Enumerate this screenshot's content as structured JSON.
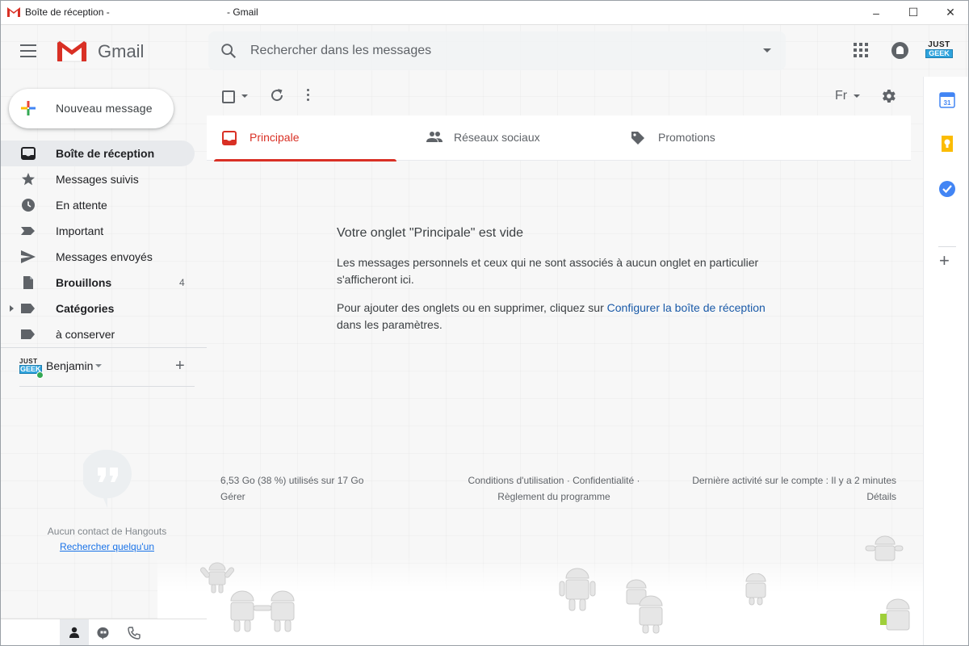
{
  "window": {
    "title_left": "Boîte de réception -",
    "title_right": "- Gmail",
    "minimize": "–",
    "maximize": "☐",
    "close": "✕"
  },
  "header": {
    "app_name": "Gmail",
    "search_placeholder": "Rechercher dans les messages",
    "account_logo_top": "JUST",
    "account_logo_bottom": "GEEK"
  },
  "compose": {
    "label": "Nouveau message"
  },
  "nav": {
    "items": [
      {
        "label": "Boîte de réception",
        "icon": "inbox-icon",
        "active": true
      },
      {
        "label": "Messages suivis",
        "icon": "star-icon"
      },
      {
        "label": "En attente",
        "icon": "clock-icon"
      },
      {
        "label": "Important",
        "icon": "important-icon"
      },
      {
        "label": "Messages envoyés",
        "icon": "send-icon"
      },
      {
        "label": "Brouillons",
        "icon": "draft-icon",
        "count": "4"
      },
      {
        "label": "Catégories",
        "icon": "label-icon"
      },
      {
        "label": "à conserver",
        "icon": "label-icon"
      }
    ]
  },
  "hangouts": {
    "user_name": "Benjamin",
    "avatar_top": "JUST",
    "avatar_bottom": "GEEK",
    "no_contact": "Aucun contact de Hangouts",
    "find_someone": "Rechercher quelqu'un"
  },
  "toolbar": {
    "language": "Fr"
  },
  "tabs": [
    {
      "label": "Principale",
      "icon": "inbox-tab-icon",
      "active": true
    },
    {
      "label": "Réseaux sociaux",
      "icon": "people-icon"
    },
    {
      "label": "Promotions",
      "icon": "tag-icon"
    }
  ],
  "empty_state": {
    "title": "Votre onglet \"Principale\" est vide",
    "paragraph1": "Les messages personnels et ceux qui ne sont associés à aucun onglet en particulier s'afficheront ici.",
    "paragraph2_before": "Pour ajouter des onglets ou en supprimer, cliquez sur ",
    "paragraph2_link": "Configurer la boîte de réception",
    "paragraph2_after": " dans les paramètres."
  },
  "footer": {
    "storage": "6,53 Go (38 %) utilisés sur 17 Go",
    "manage": "Gérer",
    "terms_line1": "Conditions d'utilisation · Confidentialité ·",
    "terms_line2": "Règlement du programme",
    "activity": "Dernière activité sur le compte : Il y a 2 minutes",
    "details": "Détails"
  },
  "side_panel": {
    "calendar_day": "31",
    "items": [
      "calendar-icon",
      "keep-icon",
      "tasks-icon"
    ]
  },
  "colors": {
    "accent_red": "#d93025",
    "link_blue": "#1a5aa8",
    "active_nav_bg": "#e8eaed"
  }
}
